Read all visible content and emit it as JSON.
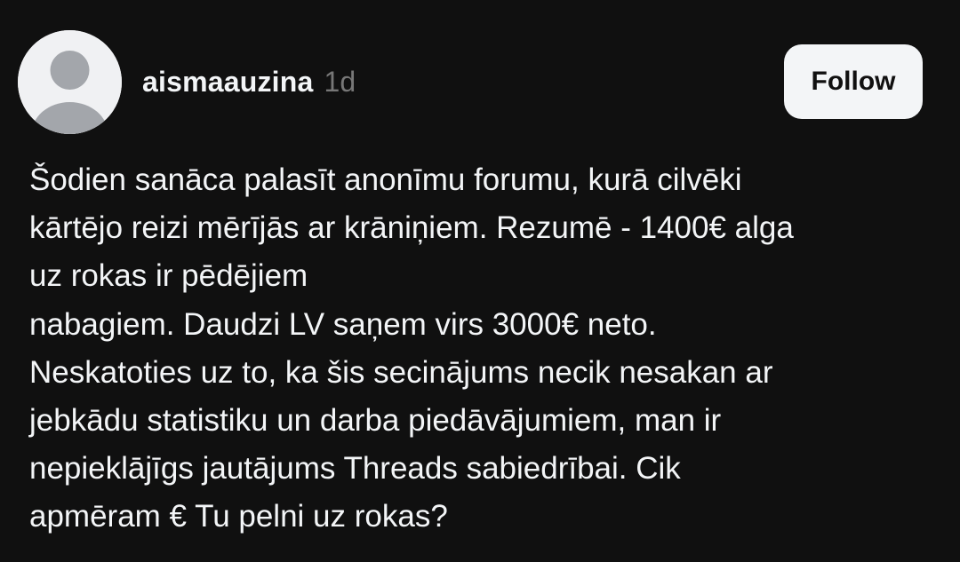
{
  "post": {
    "author": {
      "username": "aismaauzina",
      "timestamp": "1d",
      "avatar_icon": "default-avatar-icon"
    },
    "follow_label": "Follow",
    "body_lines": [
      "Šodien sanāca palasīt anonīmu forumu, kurā cilvēki",
      "kārtējo reizi mērījās ar krāniņiem. Rezumē - 1400€ alga",
      "uz rokas ir pēdējiem",
      "nabagiem. Daudzi LV saņem virs 3000€ neto.",
      "Neskatoties uz to, ka šis secinājums necik nesakan ar",
      "jebkādu statistiku un darba piedāvājumiem, man ir",
      "nepieklājīgs jautājums Threads sabiedrībai. Cik",
      "apmēram € Tu pelni uz rokas?"
    ]
  },
  "theme": {
    "background": "#101010",
    "text": "#f3f5f7",
    "muted": "#777777",
    "button_bg": "#f3f5f7",
    "button_text": "#101010",
    "avatar_bg": "#f0f1f3",
    "avatar_figure": "#a3a6ab"
  }
}
